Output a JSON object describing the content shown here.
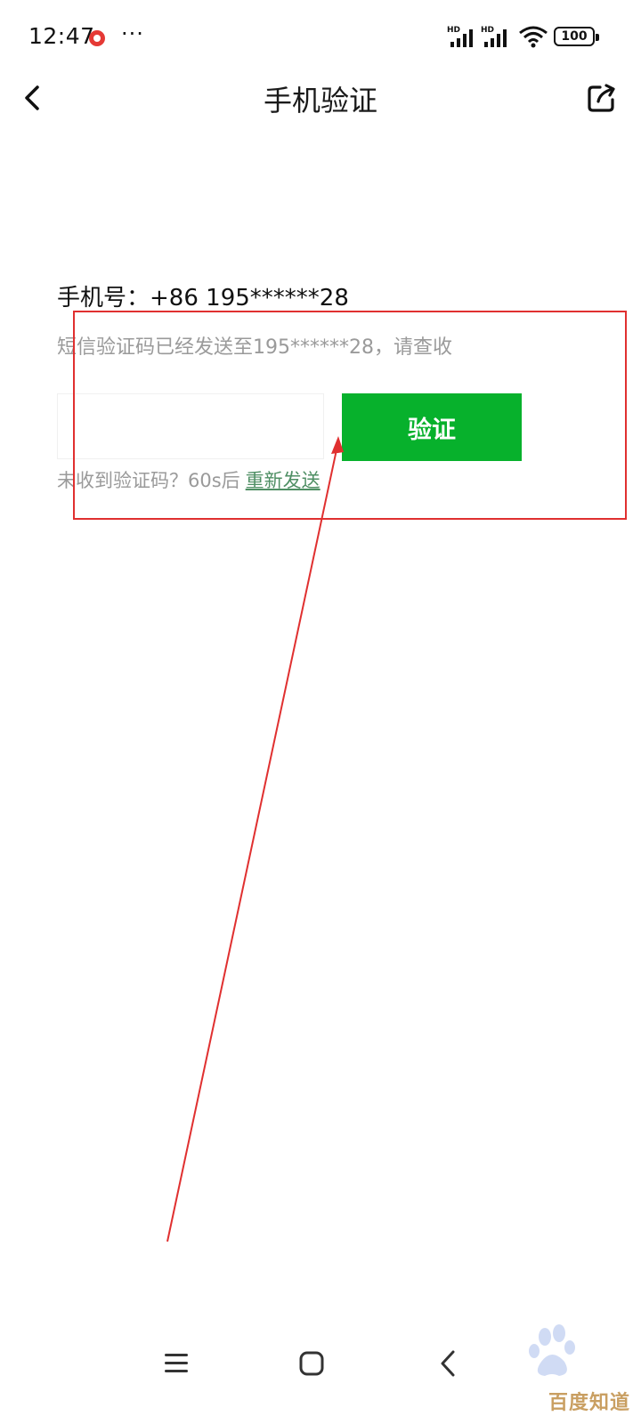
{
  "status_bar": {
    "time": "12:47",
    "more": "···",
    "signal_label_1": "HD",
    "signal_label_2": "HD",
    "battery": "100"
  },
  "header": {
    "title": "手机验证"
  },
  "form": {
    "phone_label": "手机号：",
    "phone_value": "+86 195******28",
    "sms_hint": "短信验证码已经发送至195******28，请查收",
    "code_input_value": "",
    "verify_button": "验证",
    "resend_prefix": "未收到验证码？60s后",
    "resend_link": "重新发送"
  },
  "watermark": {
    "text": "百度知道"
  },
  "colors": {
    "primary_green": "#07b12c",
    "annotation_red": "#e03030",
    "hint_gray": "#9a9a9a",
    "link_green": "#4f8f64"
  }
}
